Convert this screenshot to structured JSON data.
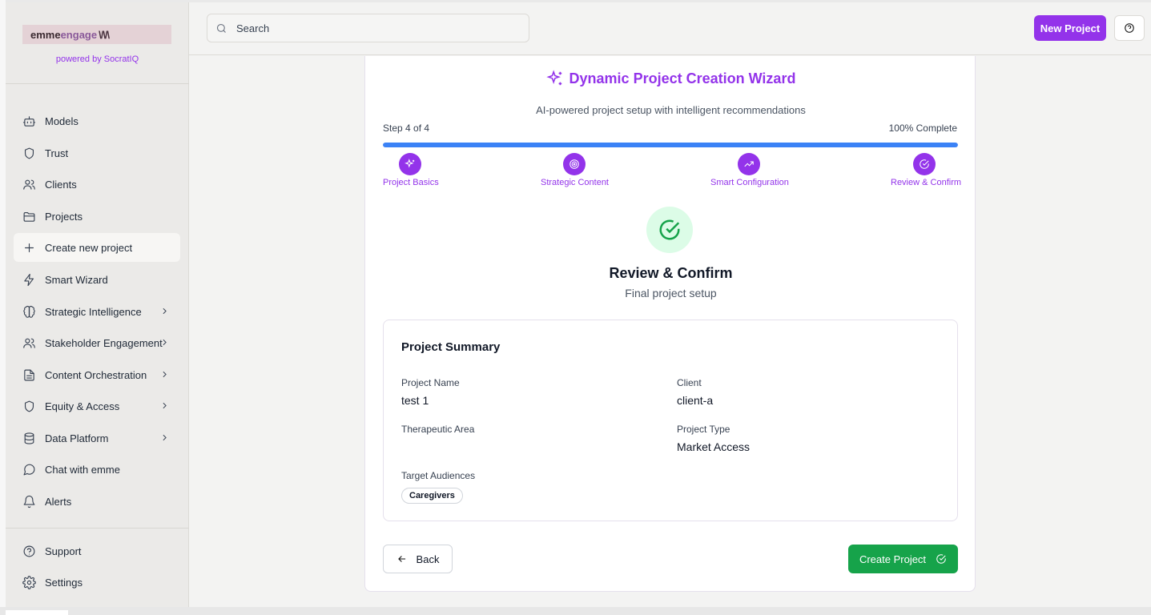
{
  "brand": {
    "logo_part1": "emme",
    "logo_part2": "engage",
    "logo_part3": "\\/\\/\\",
    "powered_by": "powered by SocratIQ"
  },
  "sidebar": {
    "items": [
      {
        "label": "Models",
        "icon": "bot-icon"
      },
      {
        "label": "Trust",
        "icon": "shield-icon"
      },
      {
        "label": "Clients",
        "icon": "users-icon"
      },
      {
        "label": "Projects",
        "icon": "folder-icon"
      },
      {
        "label": "Create new project",
        "icon": "plus-icon",
        "active": true
      },
      {
        "label": "Smart Wizard",
        "icon": "zap-icon"
      },
      {
        "label": "Strategic Intelligence",
        "icon": "brain-icon",
        "expandable": true
      },
      {
        "label": "Stakeholder Engagement",
        "icon": "users-icon",
        "expandable": true
      },
      {
        "label": "Content Orchestration",
        "icon": "file-text-icon",
        "expandable": true
      },
      {
        "label": "Equity & Access",
        "icon": "shield-icon",
        "expandable": true
      },
      {
        "label": "Data Platform",
        "icon": "database-icon",
        "expandable": true
      },
      {
        "label": "Chat with emme",
        "icon": "message-circle-icon"
      },
      {
        "label": "Alerts",
        "icon": "bell-icon"
      }
    ],
    "footer": [
      {
        "label": "Support",
        "icon": "help-circle-icon"
      },
      {
        "label": "Settings",
        "icon": "gear-icon"
      }
    ]
  },
  "topbar": {
    "search_placeholder": "Search",
    "new_project_label": "New Project"
  },
  "wizard": {
    "title": "Dynamic Project Creation Wizard",
    "subtitle": "AI-powered project setup with intelligent recommendations",
    "step_label": "Step 4 of 4",
    "percent_label": "100% Complete",
    "progress": 1.0,
    "steps": [
      {
        "label": "Project Basics",
        "icon": "sparkles-icon"
      },
      {
        "label": "Strategic Content",
        "icon": "target-icon"
      },
      {
        "label": "Smart Configuration",
        "icon": "trending-up-icon"
      },
      {
        "label": "Review & Confirm",
        "icon": "check-circle-icon"
      }
    ],
    "section_title": "Review & Confirm",
    "section_subtitle": "Final project setup"
  },
  "summary": {
    "title": "Project Summary",
    "project_name_label": "Project Name",
    "project_name_value": "test 1",
    "client_label": "Client",
    "client_value": "client-a",
    "therapeutic_area_label": "Therapeutic Area",
    "therapeutic_area_value": "",
    "project_type_label": "Project Type",
    "project_type_value": "Market Access",
    "target_audiences_label": "Target Audiences",
    "target_audiences": [
      "Caregivers"
    ]
  },
  "actions": {
    "back_label": "Back",
    "create_label": "Create Project"
  },
  "colors": {
    "accent": "#9333ea",
    "progress": "#3b82f6",
    "success": "#16a34a"
  }
}
